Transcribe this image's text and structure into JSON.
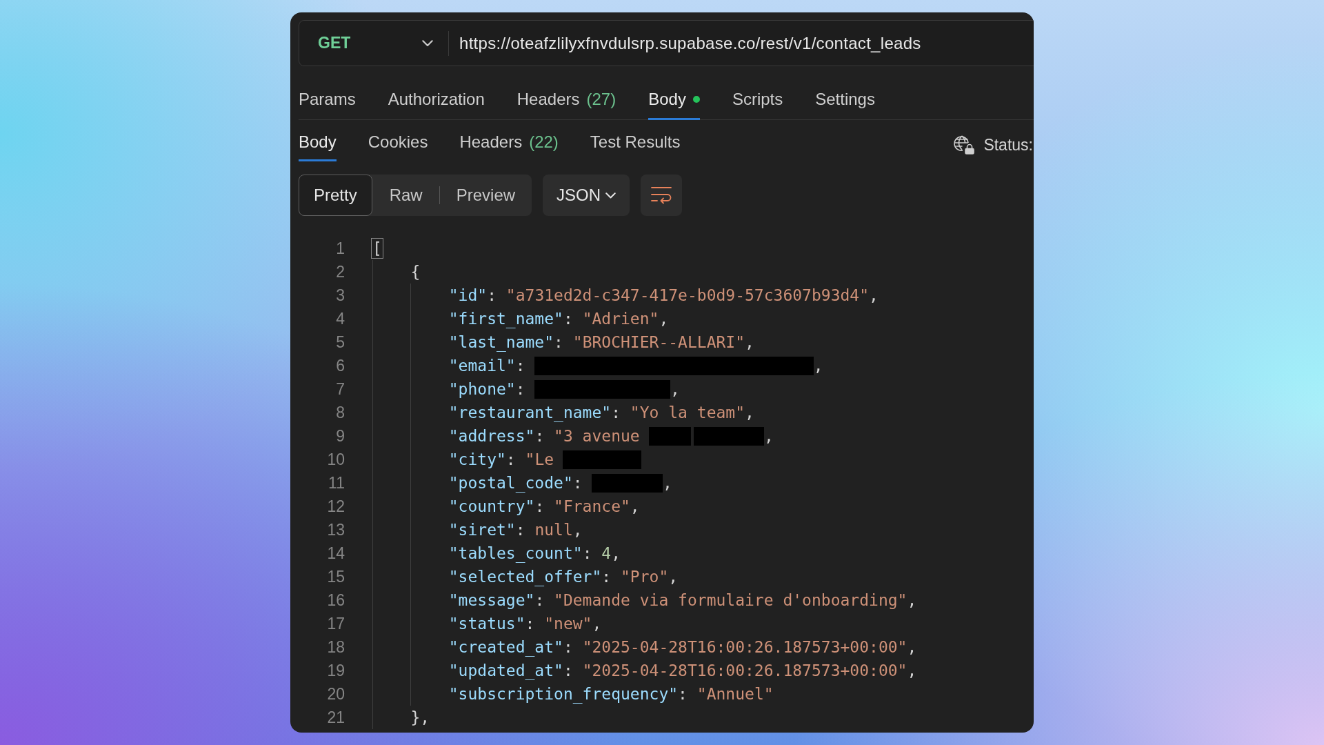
{
  "request": {
    "method": "GET",
    "url": "https://oteafzlilyxfnvdulsrp.supabase.co/rest/v1/contact_leads"
  },
  "request_tabs": [
    {
      "label": "Params",
      "selected": false,
      "dot": false
    },
    {
      "label": "Authorization",
      "selected": false,
      "dot": false
    },
    {
      "label": "Headers",
      "count": "(27)",
      "selected": false,
      "dot": false
    },
    {
      "label": "Body",
      "selected": true,
      "dot": true
    },
    {
      "label": "Scripts",
      "selected": false,
      "dot": false
    },
    {
      "label": "Settings",
      "selected": false,
      "dot": false
    }
  ],
  "response_tabs": [
    {
      "label": "Body",
      "selected": true
    },
    {
      "label": "Cookies",
      "selected": false
    },
    {
      "label": "Headers",
      "count": "(22)",
      "selected": false
    },
    {
      "label": "Test Results",
      "selected": false
    }
  ],
  "response_status": {
    "label": "Status:"
  },
  "view_modes": [
    {
      "label": "Pretty",
      "selected": true
    },
    {
      "label": "Raw",
      "selected": false
    },
    {
      "label": "Preview",
      "selected": false
    }
  ],
  "format": {
    "label": "JSON"
  },
  "code": {
    "lines": [
      {
        "number": "1",
        "tokens": [
          {
            "kind": "matched-bracket",
            "text": "["
          }
        ],
        "children": [
          {
            "number": "2",
            "tokens": [
              {
                "kind": "punct",
                "text": "{"
              }
            ],
            "children": [
              {
                "number": "3",
                "tokens": [
                  {
                    "kind": "key",
                    "text": "\"id\""
                  },
                  {
                    "kind": "punct",
                    "text": ": "
                  },
                  {
                    "kind": "string",
                    "text": "\"a731ed2d-c347-417e-b0d9-57c3607b93d4\""
                  },
                  {
                    "kind": "punct",
                    "text": ","
                  }
                ]
              },
              {
                "number": "4",
                "tokens": [
                  {
                    "kind": "key",
                    "text": "\"first_name\""
                  },
                  {
                    "kind": "punct",
                    "text": ": "
                  },
                  {
                    "kind": "string",
                    "text": "\"Adrien\""
                  },
                  {
                    "kind": "punct",
                    "text": ","
                  }
                ]
              },
              {
                "number": "5",
                "tokens": [
                  {
                    "kind": "key",
                    "text": "\"last_name\""
                  },
                  {
                    "kind": "punct",
                    "text": ": "
                  },
                  {
                    "kind": "string",
                    "text": "\"BROCHIER--ALLARI\""
                  },
                  {
                    "kind": "punct",
                    "text": ","
                  }
                ]
              },
              {
                "number": "6",
                "tokens": [
                  {
                    "kind": "key",
                    "text": "\"email\""
                  },
                  {
                    "kind": "punct",
                    "text": ": "
                  },
                  {
                    "kind": "redacted"
                  },
                  {
                    "kind": "punct",
                    "text": ","
                  }
                ]
              },
              {
                "number": "7",
                "tokens": [
                  {
                    "kind": "key",
                    "text": "\"phone\""
                  },
                  {
                    "kind": "punct",
                    "text": ": "
                  },
                  {
                    "kind": "redacted"
                  },
                  {
                    "kind": "punct",
                    "text": ","
                  }
                ]
              },
              {
                "number": "8",
                "tokens": [
                  {
                    "kind": "key",
                    "text": "\"restaurant_name\""
                  },
                  {
                    "kind": "punct",
                    "text": ": "
                  },
                  {
                    "kind": "string",
                    "text": "\"Yo la team\""
                  },
                  {
                    "kind": "punct",
                    "text": ","
                  }
                ]
              },
              {
                "number": "9",
                "tokens": [
                  {
                    "kind": "key",
                    "text": "\"address\""
                  },
                  {
                    "kind": "punct",
                    "text": ": "
                  },
                  {
                    "kind": "string",
                    "text": "\"3 avenue"
                  },
                  {
                    "kind": "redacted"
                  },
                  {
                    "kind": "redacted"
                  },
                  {
                    "kind": "punct",
                    "text": ","
                  }
                ]
              },
              {
                "number": "10",
                "tokens": [
                  {
                    "kind": "key",
                    "text": "\"city\""
                  },
                  {
                    "kind": "punct",
                    "text": ": "
                  },
                  {
                    "kind": "string",
                    "text": "\"Le"
                  },
                  {
                    "kind": "redacted"
                  }
                ]
              },
              {
                "number": "11",
                "tokens": [
                  {
                    "kind": "key",
                    "text": "\"postal_code\""
                  },
                  {
                    "kind": "punct",
                    "text": ": "
                  },
                  {
                    "kind": "redacted"
                  },
                  {
                    "kind": "punct",
                    "text": ","
                  }
                ]
              },
              {
                "number": "12",
                "tokens": [
                  {
                    "kind": "key",
                    "text": "\"country\""
                  },
                  {
                    "kind": "punct",
                    "text": ": "
                  },
                  {
                    "kind": "string",
                    "text": "\"France\""
                  },
                  {
                    "kind": "punct",
                    "text": ","
                  }
                ]
              },
              {
                "number": "13",
                "tokens": [
                  {
                    "kind": "key",
                    "text": "\"siret\""
                  },
                  {
                    "kind": "punct",
                    "text": ": "
                  },
                  {
                    "kind": "null",
                    "text": "null"
                  },
                  {
                    "kind": "punct",
                    "text": ","
                  }
                ]
              },
              {
                "number": "14",
                "tokens": [
                  {
                    "kind": "key",
                    "text": "\"tables_count\""
                  },
                  {
                    "kind": "punct",
                    "text": ": "
                  },
                  {
                    "kind": "number",
                    "text": "4"
                  },
                  {
                    "kind": "punct",
                    "text": ","
                  }
                ]
              },
              {
                "number": "15",
                "tokens": [
                  {
                    "kind": "key",
                    "text": "\"selected_offer\""
                  },
                  {
                    "kind": "punct",
                    "text": ": "
                  },
                  {
                    "kind": "string",
                    "text": "\"Pro\""
                  },
                  {
                    "kind": "punct",
                    "text": ","
                  }
                ]
              },
              {
                "number": "16",
                "tokens": [
                  {
                    "kind": "key",
                    "text": "\"message\""
                  },
                  {
                    "kind": "punct",
                    "text": ": "
                  },
                  {
                    "kind": "string",
                    "text": "\"Demande via formulaire d'onboarding\""
                  },
                  {
                    "kind": "punct",
                    "text": ","
                  }
                ]
              },
              {
                "number": "17",
                "tokens": [
                  {
                    "kind": "key",
                    "text": "\"status\""
                  },
                  {
                    "kind": "punct",
                    "text": ": "
                  },
                  {
                    "kind": "string",
                    "text": "\"new\""
                  },
                  {
                    "kind": "punct",
                    "text": ","
                  }
                ]
              },
              {
                "number": "18",
                "tokens": [
                  {
                    "kind": "key",
                    "text": "\"created_at\""
                  },
                  {
                    "kind": "punct",
                    "text": ": "
                  },
                  {
                    "kind": "string",
                    "text": "\"2025-04-28T16:00:26.187573+00:00\""
                  },
                  {
                    "kind": "punct",
                    "text": ","
                  }
                ]
              },
              {
                "number": "19",
                "tokens": [
                  {
                    "kind": "key",
                    "text": "\"updated_at\""
                  },
                  {
                    "kind": "punct",
                    "text": ": "
                  },
                  {
                    "kind": "string",
                    "text": "\"2025-04-28T16:00:26.187573+00:00\""
                  },
                  {
                    "kind": "punct",
                    "text": ","
                  }
                ]
              },
              {
                "number": "20",
                "tokens": [
                  {
                    "kind": "key",
                    "text": "\"subscription_frequency\""
                  },
                  {
                    "kind": "punct",
                    "text": ": "
                  },
                  {
                    "kind": "string",
                    "text": "\"Annuel\""
                  }
                ]
              }
            ]
          },
          {
            "number": "21",
            "tokens": [
              {
                "kind": "punct",
                "text": "},"
              }
            ]
          }
        ]
      }
    ]
  }
}
